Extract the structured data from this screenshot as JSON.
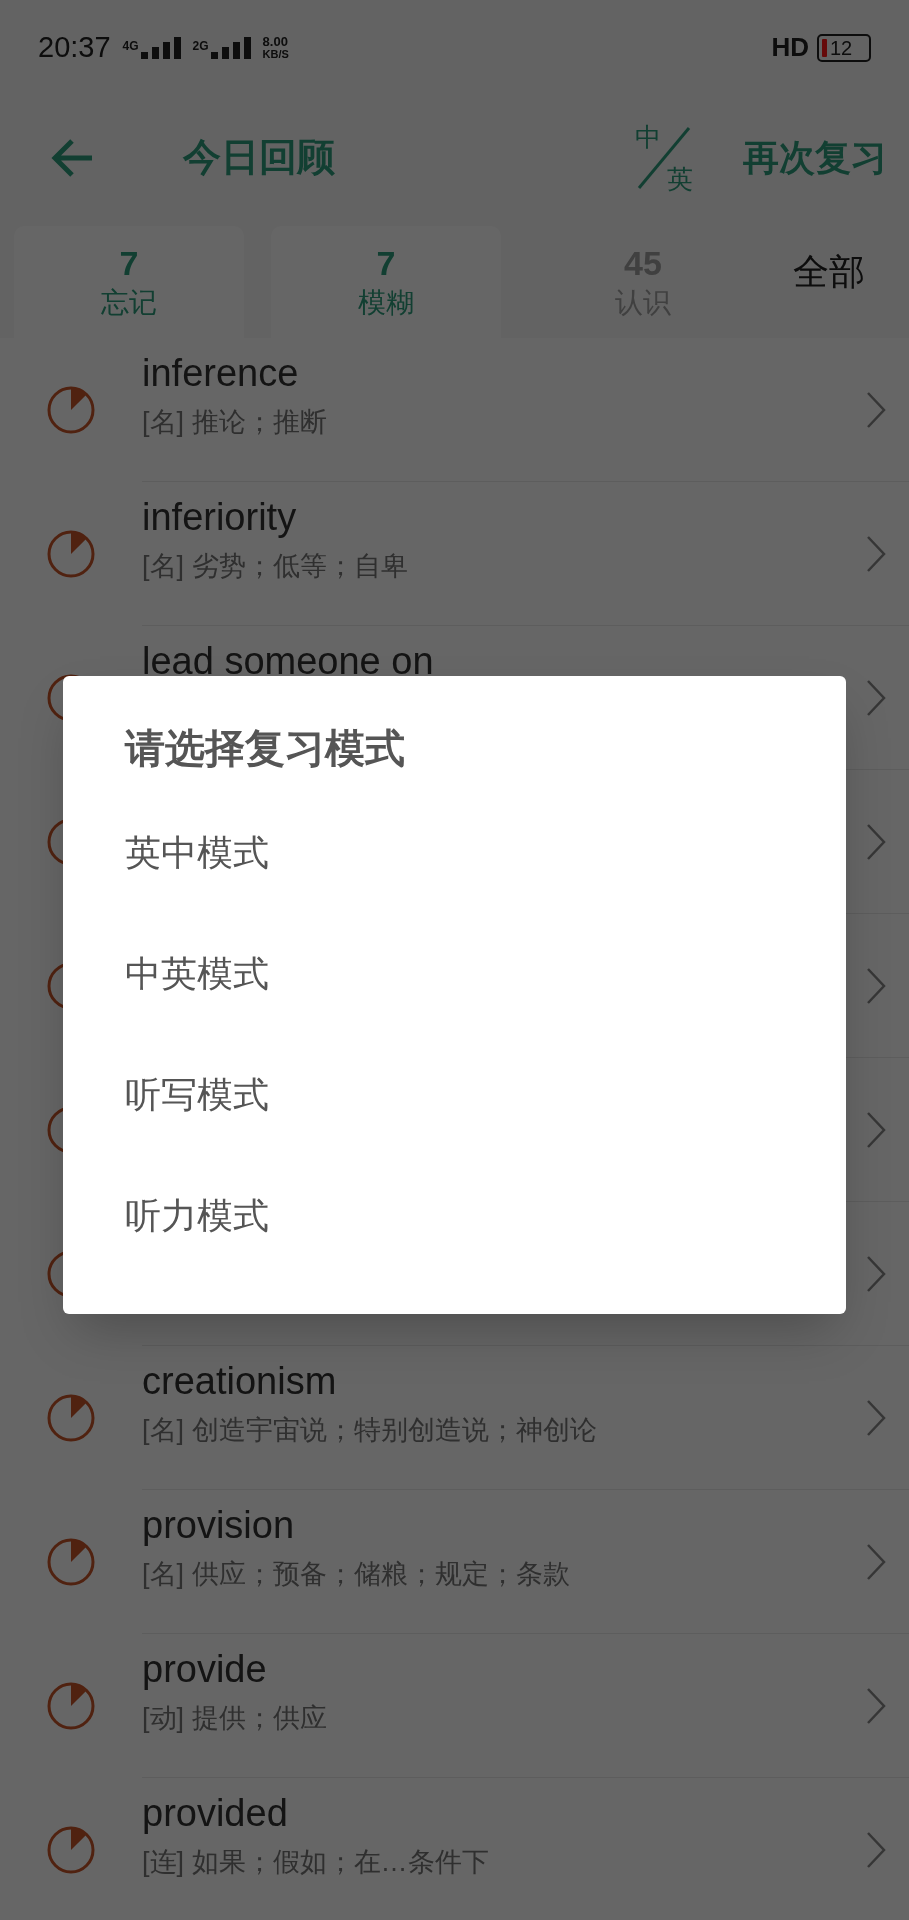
{
  "status_bar": {
    "time": "20:37",
    "sim1": "4G",
    "sim2": "2G",
    "speed_value": "8.00",
    "speed_unit": "KB/S",
    "hd": "HD",
    "battery": "12"
  },
  "header": {
    "title": "今日回顾",
    "lang_top": "中",
    "lang_bottom": "英",
    "action": "再次复习"
  },
  "tabs": [
    {
      "kind": "filter",
      "count": "7",
      "label": "忘记",
      "on": true
    },
    {
      "kind": "filter",
      "count": "7",
      "label": "模糊",
      "on": true
    },
    {
      "kind": "filter",
      "count": "45",
      "label": "认识",
      "on": false
    },
    {
      "kind": "all",
      "label": "全部"
    }
  ],
  "words": [
    {
      "kind": "word",
      "word": "inference",
      "meaning": "[名] 推论；推断"
    },
    {
      "kind": "word",
      "word": "inferiority",
      "meaning": "[名] 劣势；低等；自卑"
    },
    {
      "kind": "word",
      "word": "lead someone on"
    },
    {
      "kind": "covered"
    },
    {
      "kind": "covered"
    },
    {
      "kind": "covered"
    },
    {
      "kind": "covered"
    },
    {
      "kind": "word",
      "word": "creationism",
      "meaning": "[名] 创造宇宙说；特别创造说；神创论"
    },
    {
      "kind": "word",
      "word": "provision",
      "meaning": "[名] 供应；预备；储粮；规定；条款"
    },
    {
      "kind": "word",
      "word": "provide",
      "meaning": "[动] 提供；供应"
    },
    {
      "kind": "word",
      "word": "provided",
      "meaning": "[连] 如果；假如；在…条件下"
    }
  ],
  "dialog": {
    "title": "请选择复习模式",
    "options": [
      "英中模式",
      "中英模式",
      "听写模式",
      "听力模式"
    ]
  }
}
